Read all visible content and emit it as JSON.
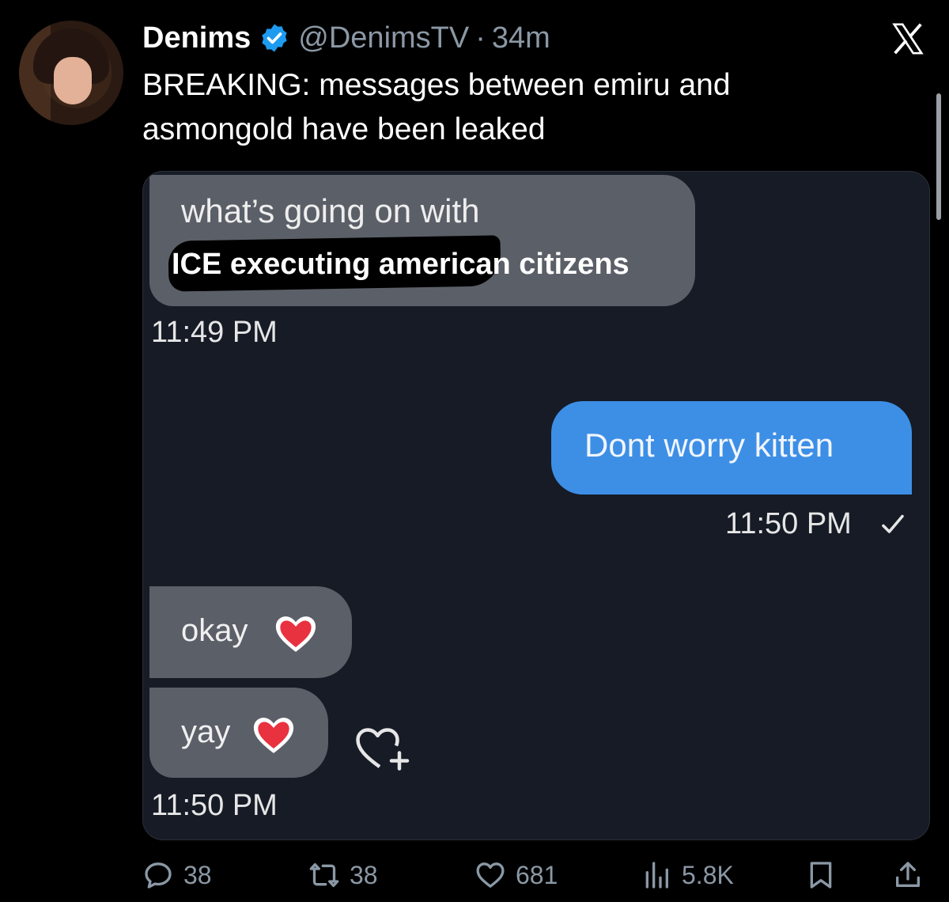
{
  "author": {
    "name": "Denims",
    "handle": "@DenimsTV",
    "separator": "·",
    "time": "34m",
    "verified": true
  },
  "tweet_text": "BREAKING: messages between emiru and asmongold have been leaked",
  "media": {
    "msg1_line1": "what’s going on with",
    "msg1_line2": "ICE executing american citizens",
    "time1": "11:49 PM",
    "msg2": "Dont worry kitten",
    "time2": "11:50 PM",
    "msg3": "okay",
    "msg4": "yay",
    "time3": "11:50 PM"
  },
  "actions": {
    "replies": "38",
    "reposts": "38",
    "likes": "681",
    "views": "5.8K"
  },
  "colors": {
    "background": "#000000",
    "secondary_text": "#8b98a5",
    "verified_badge": "#1d9bf0",
    "outgoing_bubble": "#3d8fe6",
    "incoming_bubble": "#5b5f68"
  },
  "icons": [
    "verified-icon",
    "x-logo-icon",
    "reply-icon",
    "repost-icon",
    "like-icon",
    "views-icon",
    "bookmark-icon",
    "share-icon",
    "heart-emoji-icon",
    "add-reaction-icon",
    "read-check-icon"
  ]
}
